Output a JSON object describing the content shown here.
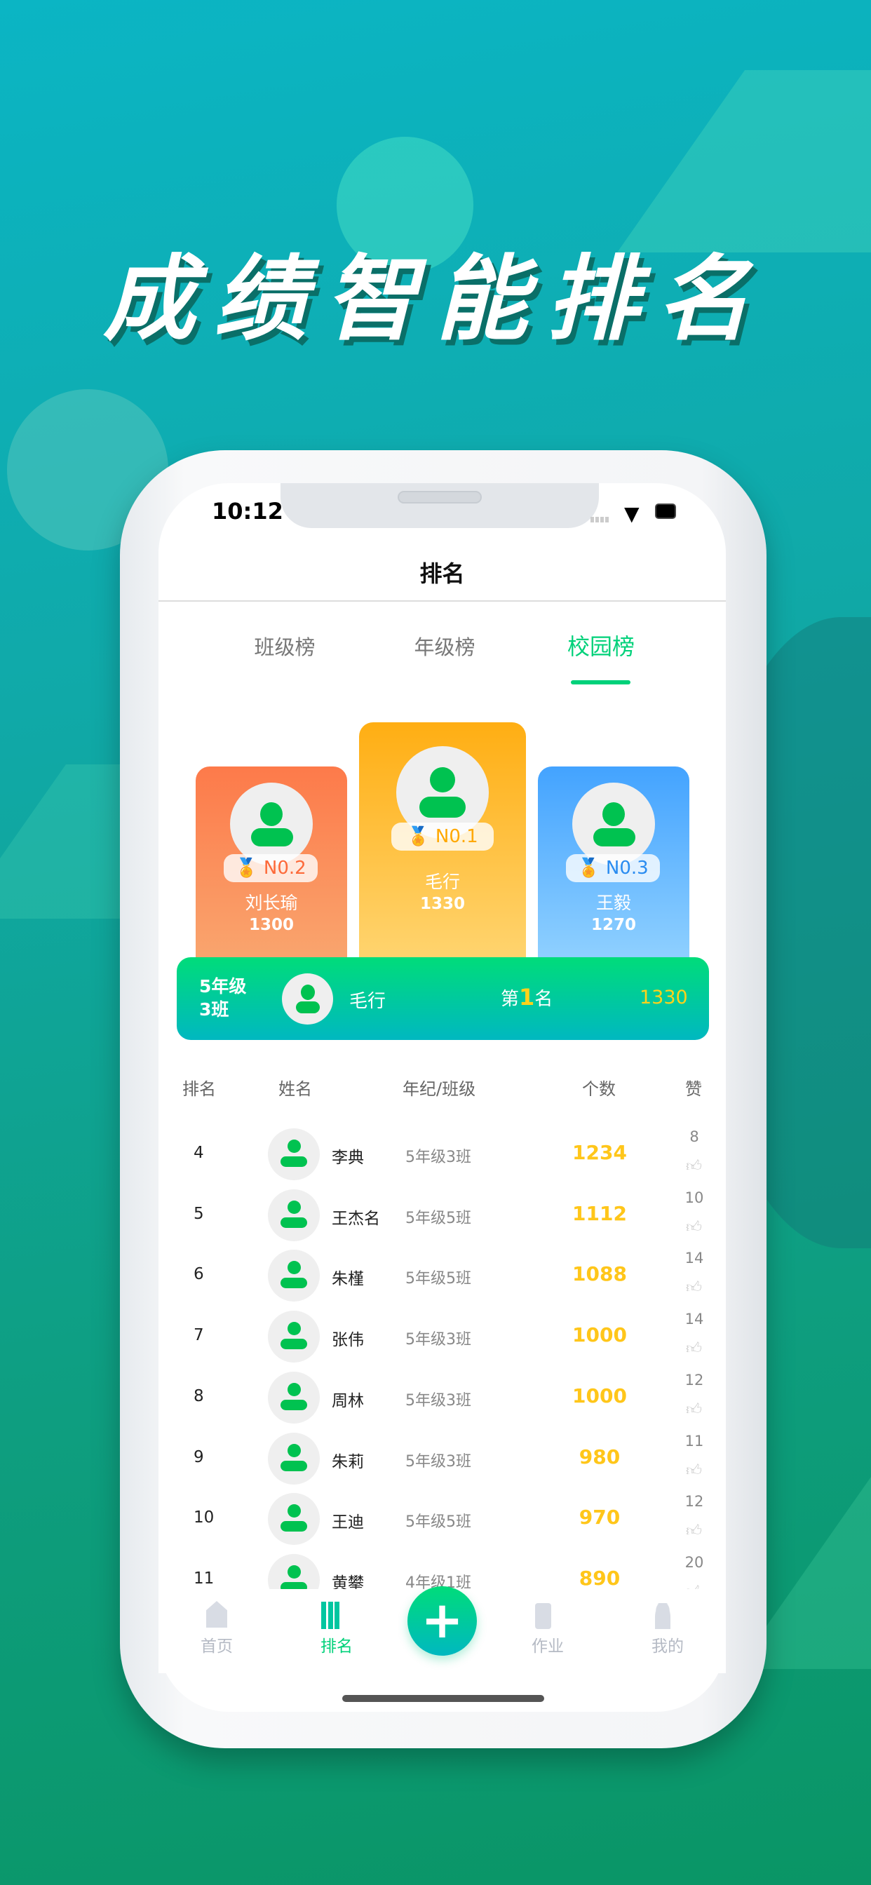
{
  "hero_title": "成绩智能排名",
  "status_bar": {
    "time": "10:12"
  },
  "header": {
    "title": "排名"
  },
  "tabs": [
    {
      "label": "班级榜"
    },
    {
      "label": "年级榜"
    },
    {
      "label": "校园榜",
      "active": true
    }
  ],
  "podium": {
    "first": {
      "badge": "N0.1",
      "name": "毛行",
      "score": "1330"
    },
    "second": {
      "badge": "N0.2",
      "name": "刘长瑜",
      "score": "1300"
    },
    "third": {
      "badge": "N0.3",
      "name": "王毅",
      "score": "1270"
    }
  },
  "my_rank": {
    "class_line1": "5年级",
    "class_line2": "3班",
    "name": "毛行",
    "rank_prefix": "第",
    "rank": "1",
    "rank_suffix": "名",
    "score": "1330"
  },
  "table": {
    "headers": {
      "rank": "排名",
      "name": "姓名",
      "class": "年纪/班级",
      "count": "个数",
      "likes": "赞"
    },
    "rows": [
      {
        "rank": "4",
        "name": "李典",
        "class": "5年级3班",
        "count": "1234",
        "likes": "8"
      },
      {
        "rank": "5",
        "name": "王杰名",
        "class": "5年级5班",
        "count": "1112",
        "likes": "10"
      },
      {
        "rank": "6",
        "name": "朱槿",
        "class": "5年级5班",
        "count": "1088",
        "likes": "14"
      },
      {
        "rank": "7",
        "name": "张伟",
        "class": "5年级3班",
        "count": "1000",
        "likes": "14"
      },
      {
        "rank": "8",
        "name": "周林",
        "class": "5年级3班",
        "count": "1000",
        "likes": "12"
      },
      {
        "rank": "9",
        "name": "朱莉",
        "class": "5年级3班",
        "count": "980",
        "likes": "11"
      },
      {
        "rank": "10",
        "name": "王迪",
        "class": "5年级5班",
        "count": "970",
        "likes": "12"
      },
      {
        "rank": "11",
        "name": "黄攀",
        "class": "4年级1班",
        "count": "890",
        "likes": "20"
      }
    ]
  },
  "tab_bar": [
    {
      "label": "首页",
      "icon": "home-icon"
    },
    {
      "label": "排名",
      "icon": "bar-chart-icon",
      "active": true
    },
    {
      "label": "",
      "icon": "plus-icon"
    },
    {
      "label": "作业",
      "icon": "clipboard-icon"
    },
    {
      "label": "我的",
      "icon": "user-icon"
    }
  ],
  "colors": {
    "accent": "#00d17a",
    "score": "#ffc61a",
    "second": "#fd7a4a",
    "first": "#ffb013",
    "third": "#43a3ff"
  }
}
